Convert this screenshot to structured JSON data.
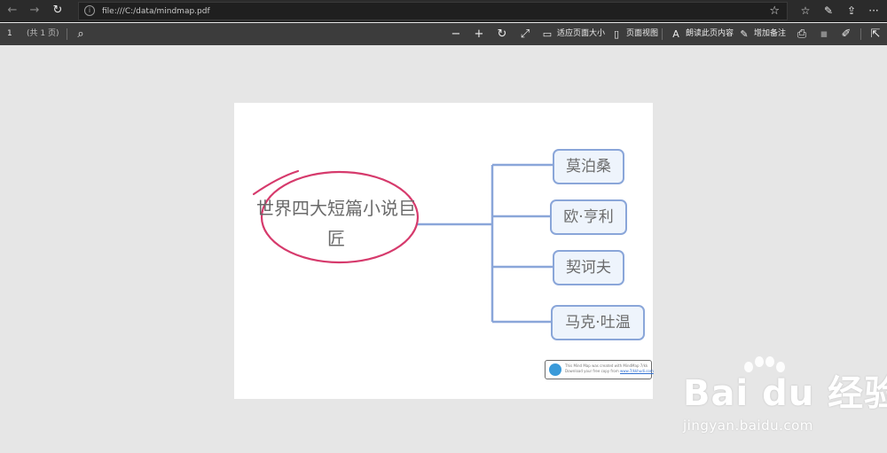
{
  "browser": {
    "url": "file:///C:/data/mindmap.pdf"
  },
  "pdf_toolbar": {
    "page_number": "1",
    "page_total": "(共 1 页)",
    "fit_page_label": "适应页面大小",
    "page_view_label": "页面视图",
    "read_aloud_label": "朗读此页内容",
    "add_note_label": "增加备注"
  },
  "mindmap": {
    "central_topic": "世界四大短篇小说巨匠",
    "branches": [
      "莫泊桑",
      "欧·亨利",
      "契诃夫",
      "马克·吐温"
    ],
    "badge_line1": "This Mind Map was created with MindMap 7/kk",
    "badge_line2": "Download your free copy from",
    "badge_link": "www.7/kkhudi.com"
  },
  "watermark": {
    "logo_text": "Bai du 经验",
    "url_text": "jingyan.baidu.com"
  },
  "colors": {
    "node_border": "#8aa6d9",
    "node_fill": "#eef4fc",
    "annotation_ink": "#d63a6c",
    "toolbar_bg": "#3c3c3c"
  }
}
